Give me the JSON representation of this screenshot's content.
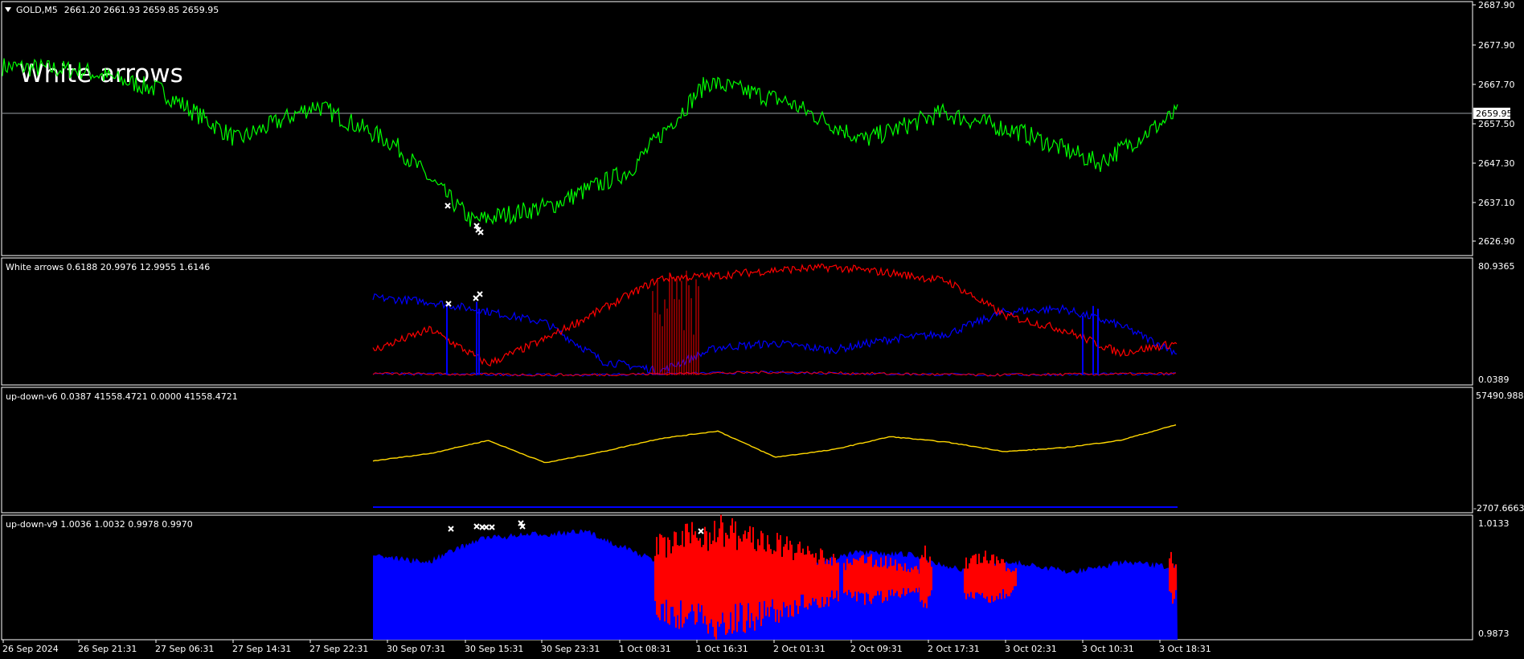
{
  "window": {
    "symbol_label": "GOLD,M5",
    "ohlc": "2661.20 2661.93 2659.85 2659.95",
    "menu_icon": "triangle-down-icon"
  },
  "overlay_text": "White arrows",
  "colors": {
    "background": "#000000",
    "axis": "#ffffff",
    "price_line": "#00ff00",
    "blue": "#0000ff",
    "red": "#ff0000",
    "yellow": "#ffd700",
    "marker": "#ffffff",
    "hline": "#9aa0a6"
  },
  "panes": [
    {
      "id": "price",
      "title": "GOLD,M5  2661.20 2661.93 2659.85 2659.95",
      "ticks": [
        "2687.90",
        "2677.90",
        "2667.70",
        "2657.50",
        "2647.30",
        "2637.10",
        "2626.90"
      ],
      "current_price": "2659.95"
    },
    {
      "id": "white-arrows",
      "title": "White arrows 0.6188 20.9976 12.9955 1.6146",
      "ticks": [
        "80.9365",
        "0.0389"
      ]
    },
    {
      "id": "up-down-v6",
      "title": "up-down-v6 0.0387 41558.4721 0.0000 41558.4721",
      "ticks": [
        "57490.988",
        "-2707.6663"
      ]
    },
    {
      "id": "up-down-v9",
      "title": "up-down-v9 1.0036 1.0032 0.9978 0.9970",
      "ticks": [
        "1.0133",
        "0.9873"
      ]
    }
  ],
  "time_axis": [
    "26 Sep 2024",
    "26 Sep 21:31",
    "27 Sep 06:31",
    "27 Sep 14:31",
    "27 Sep 22:31",
    "30 Sep 07:31",
    "30 Sep 15:31",
    "30 Sep 23:31",
    "1 Oct 08:31",
    "1 Oct 16:31",
    "2 Oct 01:31",
    "2 Oct 09:31",
    "2 Oct 17:31",
    "3 Oct 02:31",
    "3 Oct 10:31",
    "3 Oct 18:31"
  ],
  "chart_data": {
    "type": "line",
    "price_series": {
      "x": [
        "26 Sep 2024",
        "26 Sep 21:31",
        "27 Sep 06:31",
        "27 Sep 14:31",
        "27 Sep 22:31",
        "30 Sep 07:31",
        "30 Sep 15:31",
        "30 Sep 23:31",
        "1 Oct 08:31",
        "1 Oct 16:31",
        "2 Oct 01:31",
        "2 Oct 09:31",
        "2 Oct 17:31",
        "3 Oct 02:31",
        "3 Oct 10:31",
        "3 Oct 18:31"
      ],
      "values": [
        2672,
        2671,
        2666,
        2653,
        2662,
        2652,
        2632,
        2636,
        2645,
        2668,
        2663,
        2653,
        2660,
        2655,
        2647,
        2660
      ],
      "ylim": [
        2626.9,
        2687.9
      ]
    },
    "white_arrows_series": {
      "names": [],
      "ylim": [
        0.0389,
        80.9365
      ],
      "blue": [
        58,
        55,
        48,
        40,
        12,
        5,
        22,
        25,
        20,
        28,
        32,
        48,
        50,
        38,
        18
      ],
      "red": [
        20,
        35,
        10,
        28,
        50,
        72,
        74,
        78,
        80,
        76,
        70,
        45,
        35,
        18,
        25
      ]
    },
    "up_down_v6_series": {
      "ylim": [
        -2707.6663,
        57490.988
      ],
      "yellow": [
        22000,
        26000,
        33000,
        21000,
        27000,
        34000,
        38000,
        24000,
        28000,
        35000,
        32000,
        27000,
        29000,
        33000,
        41558
      ]
    },
    "up_down_v9_series": {
      "ylim": [
        0.9873,
        1.0133
      ]
    }
  }
}
